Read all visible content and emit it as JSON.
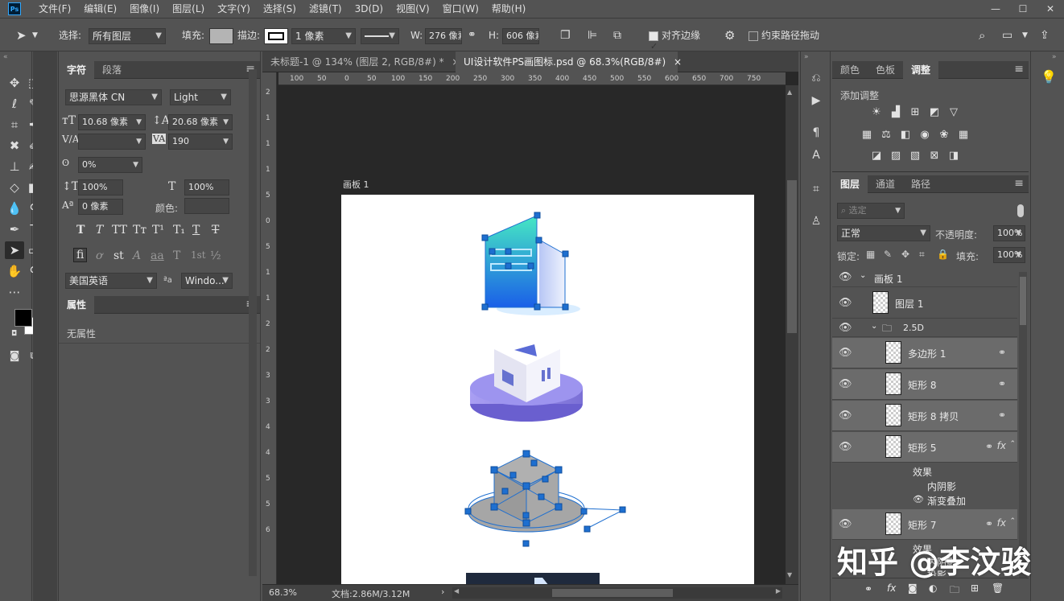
{
  "app": {
    "logo": "Ps"
  },
  "menu": [
    "文件(F)",
    "编辑(E)",
    "图像(I)",
    "图层(L)",
    "文字(Y)",
    "选择(S)",
    "滤镜(T)",
    "3D(D)",
    "视图(V)",
    "窗口(W)",
    "帮助(H)"
  ],
  "window_controls": {
    "minimize": "—",
    "maximize": "☐",
    "close": "✕"
  },
  "options": {
    "select_label": "选择:",
    "select_value": "所有图层",
    "fill_label": "填充:",
    "stroke_label": "描边:",
    "stroke_width": "1 像素",
    "w_label": "W:",
    "w_value": "276 像素",
    "h_label": "H:",
    "h_value": "606 像素",
    "align_edges": "对齐边缘",
    "constrain_path": "约束路径拖动",
    "fill_color": "#b4b4b4"
  },
  "character": {
    "tabs": [
      "字符",
      "段落"
    ],
    "font_family": "思源黑体 CN",
    "font_style": "Light",
    "size": "10.68 像素",
    "leading": "20.68 像素",
    "kerning": "",
    "tracking": "190",
    "scale_tsume": "0%",
    "vscale": "100%",
    "hscale": "100%",
    "baseline": "0 像素",
    "color_label": "颜色:",
    "glyphs": [
      "T",
      "T",
      "TT",
      "Tт",
      "T¹",
      "T₁",
      "T",
      "T"
    ],
    "otglyphs": [
      "fi",
      "ơ",
      "st",
      "A",
      "aa",
      "T",
      "1st",
      "½"
    ],
    "language": "美国英语",
    "aa_label": "ªa",
    "aa_value": "Windo..."
  },
  "properties": {
    "title": "属性",
    "empty": "无属性"
  },
  "doc": {
    "tabs": [
      "未标题-1 @ 134% (图层 2, RGB/8#) *",
      "UI设计软件PS画图标.psd @ 68.3%(RGB/8#)"
    ],
    "close": "×",
    "artboard_label": "画板 1",
    "zoom": "68.3%",
    "doc_size": "文档:2.86M/3.12M",
    "ruler_h": [
      "100",
      "50",
      "0",
      "50",
      "100",
      "150",
      "200",
      "250",
      "300",
      "350",
      "400",
      "450",
      "500",
      "550",
      "600",
      "650",
      "700",
      "750"
    ],
    "ruler_v": [
      "2",
      "1",
      "1",
      "1",
      "5",
      "0",
      "5",
      "1",
      "1",
      "2",
      "2",
      "3",
      "3",
      "4",
      "4",
      "5",
      "5",
      "6"
    ]
  },
  "adjustments": {
    "tabs": [
      "颜色",
      "色板",
      "调整"
    ],
    "title": "添加调整"
  },
  "layers": {
    "tabs": [
      "图层",
      "通道",
      "路径"
    ],
    "filter_placeholder": "选定",
    "blend_mode": "正常",
    "opacity_label": "不透明度:",
    "opacity": "100%",
    "lock_label": "锁定:",
    "fill_label": "填充:",
    "fill": "100%",
    "rows": [
      {
        "name": "画板 1",
        "type": "artboard"
      },
      {
        "name": "图层 1",
        "type": "layer"
      },
      {
        "name": "2.5D",
        "type": "group"
      },
      {
        "name": "多边形 1",
        "type": "shape"
      },
      {
        "name": "矩形 8",
        "type": "shape"
      },
      {
        "name": "矩形 8 拷贝",
        "type": "shape"
      },
      {
        "name": "矩形 5",
        "type": "shape",
        "fx": "fx"
      },
      {
        "name": "矩形 7",
        "type": "shape",
        "fx": "fx"
      }
    ],
    "effects_5": [
      "效果",
      "内阴影",
      "渐变叠加"
    ],
    "effects_7": [
      "效果",
      "内阴影",
      "投影"
    ]
  },
  "watermark": "知乎 @李汶骏",
  "colors": {
    "accent": "#31a8ff",
    "handle": "#1e6fd0",
    "purple": "#8f86e8"
  }
}
